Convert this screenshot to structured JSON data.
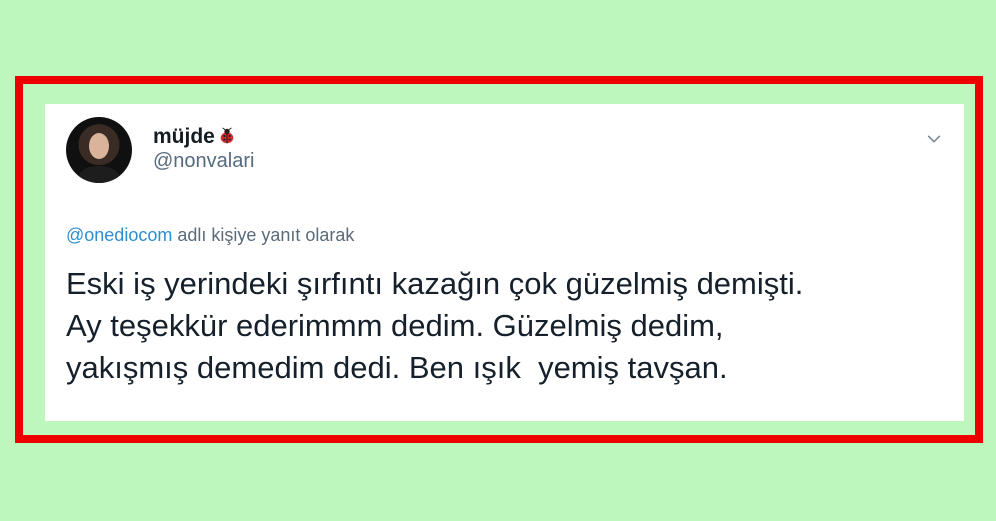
{
  "tweet": {
    "display_name": "müjde",
    "badge_icon": "ladybug-icon",
    "handle": "@nonvalari",
    "reply_context": {
      "mention": "@onediocom",
      "suffix": " adlı kişiye yanıt olarak"
    },
    "text": "Eski iş yerindeki şırfıntı kazağın çok güzelmiş demişti.\nAy teşekkür ederimmm dedim. Güzelmiş dedim,\nyakışmış demedim dedi. Ben ışık  yemiş tavşan.",
    "menu_icon": "chevron-down-icon"
  },
  "colors": {
    "background": "#bdf7bd",
    "highlight_border": "#ef0000",
    "card": "#ffffff",
    "text": "#15202b",
    "muted": "#566a7d",
    "link": "#2d8ecf"
  }
}
